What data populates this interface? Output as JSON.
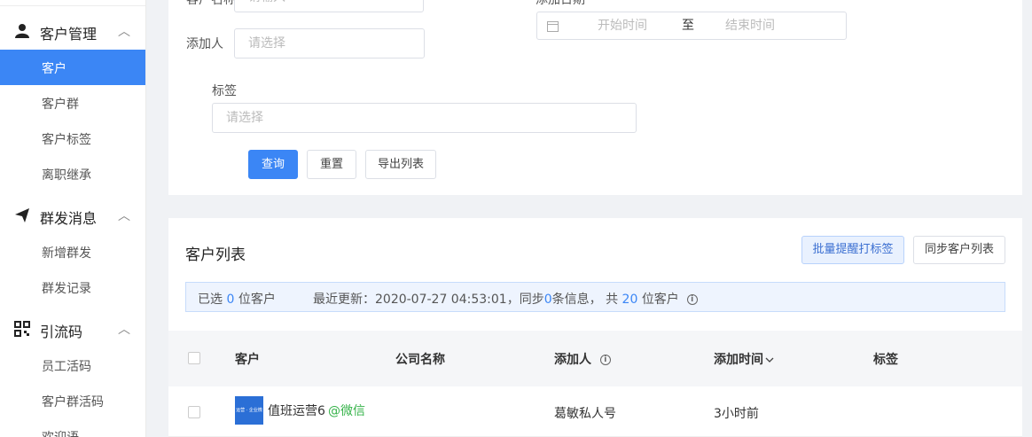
{
  "sidebar": {
    "groups": [
      {
        "label": "客户管理",
        "icon": "user-icon",
        "items": [
          "客户",
          "客户群",
          "客户标签",
          "离职继承"
        ]
      },
      {
        "label": "群发消息",
        "icon": "paper-plane-icon",
        "items": [
          "新增群发",
          "群发记录"
        ]
      },
      {
        "label": "引流码",
        "icon": "qr-code-icon",
        "items": [
          "员工活码",
          "客户群活码",
          "欢迎语"
        ]
      }
    ],
    "active_item": "客户",
    "accent": "#3b86f5"
  },
  "filter": {
    "customer_name_label": "客户名称",
    "customer_name_placeholder": "请输入",
    "add_date_label": "添加日期",
    "adder_label": "添加人",
    "adder_placeholder": "请选择",
    "date_start_placeholder": "开始时间",
    "date_separator": "至",
    "date_end_placeholder": "结束时间",
    "tag_label": "标签",
    "tag_placeholder": "请选择",
    "query_label": "查询",
    "reset_label": "重置",
    "export_label": "导出列表"
  },
  "list": {
    "title": "客户列表",
    "batch_tag_label": "批量提醒打标签",
    "sync_label": "同步客户列表",
    "info": {
      "selected_prefix": "已选",
      "selected_count": "0",
      "selected_suffix": "位客户",
      "updated_prefix": "最近更新：2020-07-27 04:53:01，同步",
      "synced_count": "0",
      "synced_suffix": "条信息，  共",
      "total_count": "20",
      "total_suffix": "位客户"
    },
    "columns": [
      "客户",
      "公司名称",
      "添加人",
      "添加时间",
      "标签"
    ],
    "rows": [
      {
        "customer": "值班运营6",
        "source": "@微信",
        "company": "",
        "adder": "葛敏私人号",
        "added_time": "3小时前",
        "tags": "",
        "avatar_text": "运营 · 企业微信"
      }
    ]
  }
}
